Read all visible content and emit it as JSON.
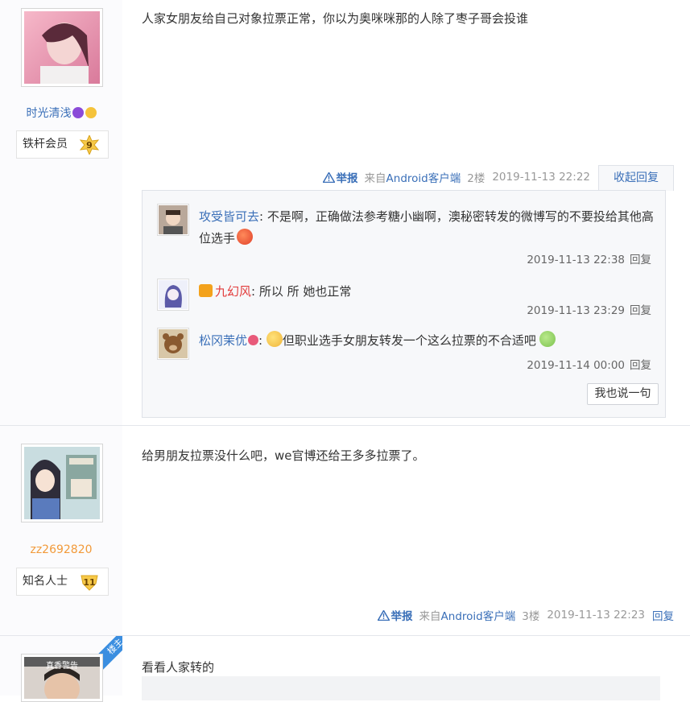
{
  "posts": [
    {
      "username": "时光清浅",
      "badge_title": "铁杆会员",
      "level": "9",
      "content": "人家女朋友给自己对象拉票正常，你以为奥咪咪那的人除了枣子哥会投谁",
      "report": "举报",
      "from_prefix": "来自",
      "from_client": "Android客户端",
      "floor": "2楼",
      "time": "2019-11-13 22:22",
      "toggle_label": "收起回复",
      "replies": [
        {
          "user": "攻受皆可去",
          "text": "不是啊，正确做法参考糖小幽啊，澳秘密转发的微博写的不要投给其他高位选手",
          "time": "2019-11-13 22:38",
          "reply_label": "回复"
        },
        {
          "user": "九幻风",
          "text": "所以  所 她也正常",
          "time": "2019-11-13 23:29",
          "reply_label": "回复"
        },
        {
          "user": "松冈茉优",
          "text": "但职业选手女朋友转发一个这么拉票的不合适吧",
          "time": "2019-11-14 00:00",
          "reply_label": "回复"
        }
      ],
      "say_button": "我也说一句"
    },
    {
      "username": "zz2692820",
      "badge_title": "知名人士",
      "level": "11",
      "content": "给男朋友拉票没什么吧，we官博还给王多多拉票了。",
      "report": "举报",
      "from_prefix": "来自",
      "from_client": "Android客户端",
      "floor": "3楼",
      "time": "2019-11-13 22:23",
      "reply_label": "回复"
    },
    {
      "ribbon": "楼主",
      "avatar_caption": "真香警告",
      "content": "看看人家转的"
    }
  ],
  "colors": {
    "link_blue": "#3a6fb8",
    "orange_name": "#f29a3a",
    "red_name": "#e23b3b",
    "gold_badge": "#f7c948"
  },
  "icons": [
    "warning-icon",
    "devil-emoji-icon",
    "surprised-emoji-icon",
    "level-badge-icon",
    "crown-icon",
    "flower-icon",
    "smug-emoji-icon",
    "sick-emoji-icon",
    "angry-emoji-icon"
  ]
}
